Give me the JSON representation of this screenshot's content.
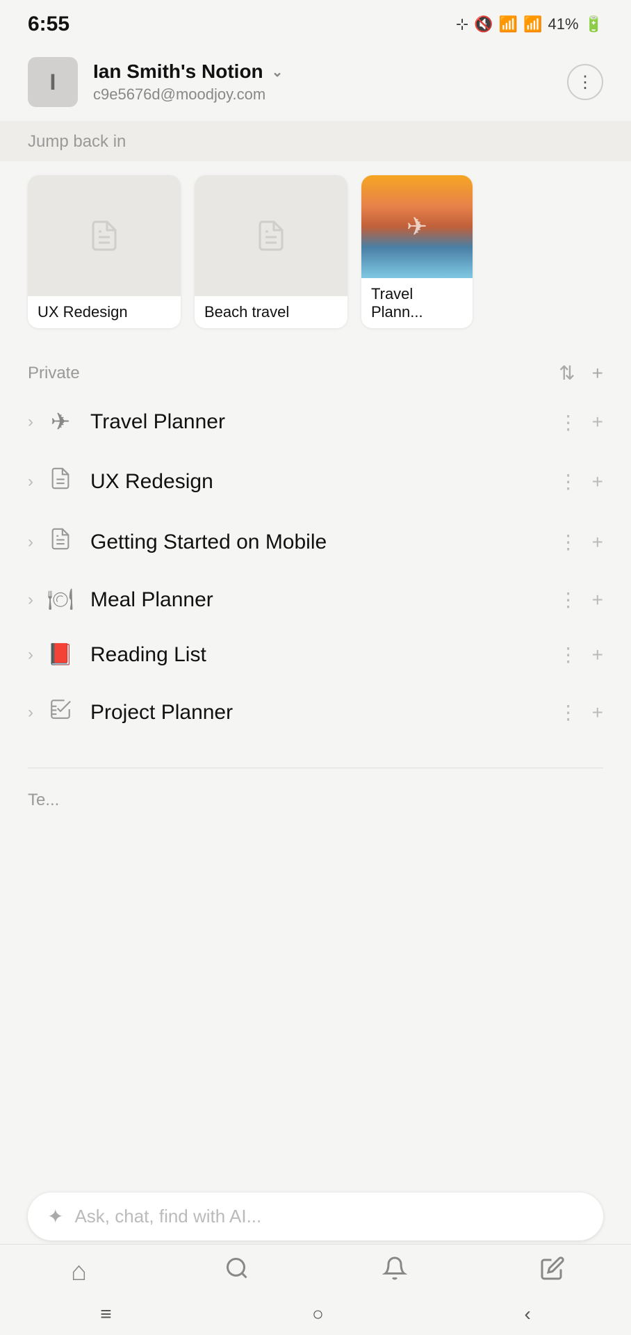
{
  "statusBar": {
    "time": "6:55",
    "battery": "41%"
  },
  "account": {
    "initial": "I",
    "name": "Ian Smith's Notion",
    "email": "c9e5676d@moodjoy.com"
  },
  "jumpBackIn": {
    "label": "Jump back in",
    "cards": [
      {
        "title": "UX Redesign",
        "type": "doc"
      },
      {
        "title": "Beach travel",
        "type": "doc"
      },
      {
        "title": "Travel Plann...",
        "type": "photo"
      }
    ]
  },
  "privateSection": {
    "label": "Private"
  },
  "navItems": [
    {
      "id": "travel-planner",
      "icon": "✈",
      "title": "Travel Planner"
    },
    {
      "id": "ux-redesign",
      "icon": "📄",
      "title": "UX Redesign"
    },
    {
      "id": "getting-started",
      "icon": "📄",
      "title": "Getting Started on Mobile"
    },
    {
      "id": "meal-planner",
      "icon": "🍽",
      "title": "Meal Planner"
    },
    {
      "id": "reading-list",
      "icon": "📕",
      "title": "Reading List"
    },
    {
      "id": "project-planner",
      "icon": "☑",
      "title": "Project Planner"
    }
  ],
  "teamSection": {
    "label": "Te..."
  },
  "aiBar": {
    "placeholder": "Ask, chat, find with AI..."
  },
  "bottomNav": [
    {
      "id": "home",
      "icon": "⌂"
    },
    {
      "id": "search",
      "icon": "⌕"
    },
    {
      "id": "notifications",
      "icon": "🔔"
    },
    {
      "id": "edit",
      "icon": "✏"
    }
  ],
  "androidNav": [
    {
      "id": "menu",
      "symbol": "≡"
    },
    {
      "id": "home-circle",
      "symbol": "○"
    },
    {
      "id": "back",
      "symbol": "‹"
    }
  ]
}
